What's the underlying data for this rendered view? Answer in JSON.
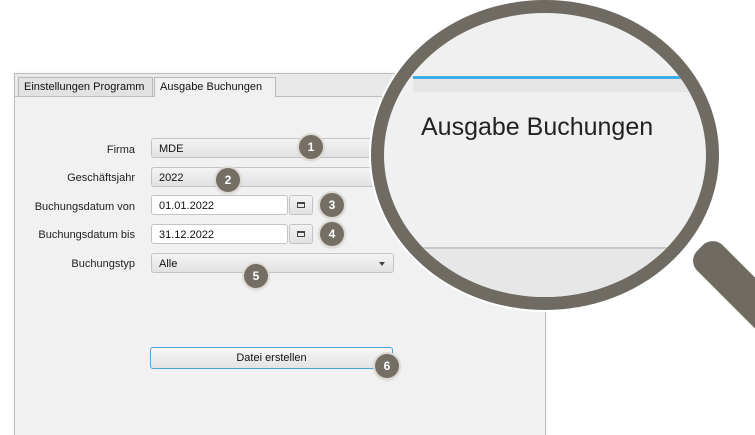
{
  "tabs": [
    {
      "label": "Einstellungen Programm"
    },
    {
      "label": "Ausgabe Buchungen"
    }
  ],
  "form": {
    "firma": {
      "label": "Firma",
      "value": "MDE"
    },
    "geschaeftsjahr": {
      "label": "Geschäftsjahr",
      "value": "2022"
    },
    "von": {
      "label": "Buchungsdatum von",
      "value": "01.01.2022"
    },
    "bis": {
      "label": "Buchungsdatum bis",
      "value": "31.12.2022"
    },
    "typ": {
      "label": "Buchungstyp",
      "value": "Alle"
    }
  },
  "create_button": "Datei erstellen",
  "badges": [
    "1",
    "2",
    "3",
    "4",
    "5",
    "6"
  ],
  "magnifier": {
    "text": "Ausgabe Buchungen"
  },
  "colors": {
    "accent": "#3daee9",
    "badge": "#746e65",
    "magnifier": "#6f6a62"
  }
}
